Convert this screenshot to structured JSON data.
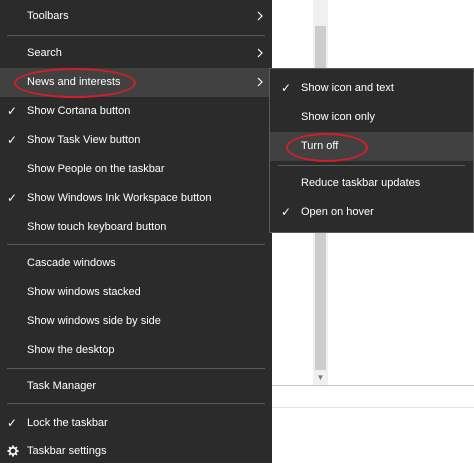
{
  "context_menu": {
    "toolbars": "Toolbars",
    "search": "Search",
    "news_and_interests": "News and interests",
    "show_cortana_button": "Show Cortana button",
    "show_task_view_button": "Show Task View button",
    "show_people_on_taskbar": "Show People on the taskbar",
    "show_windows_ink_workspace_button": "Show Windows Ink Workspace button",
    "show_touch_keyboard_button": "Show touch keyboard button",
    "cascade_windows": "Cascade windows",
    "show_windows_stacked": "Show windows stacked",
    "show_windows_side_by_side": "Show windows side by side",
    "show_the_desktop": "Show the desktop",
    "task_manager": "Task Manager",
    "lock_the_taskbar": "Lock the taskbar",
    "taskbar_settings": "Taskbar settings"
  },
  "news_submenu": {
    "show_icon_and_text": "Show icon and text",
    "show_icon_only": "Show icon only",
    "turn_off": "Turn off",
    "reduce_taskbar_updates": "Reduce taskbar updates",
    "open_on_hover": "Open on hover"
  },
  "icons": {
    "check": "check-icon",
    "chevron": "chevron-right-icon",
    "gear": "gear-icon"
  },
  "colors": {
    "menu_background": "#2b2b2b",
    "hover_background": "#414141",
    "annotation_red": "#d01f2b"
  }
}
